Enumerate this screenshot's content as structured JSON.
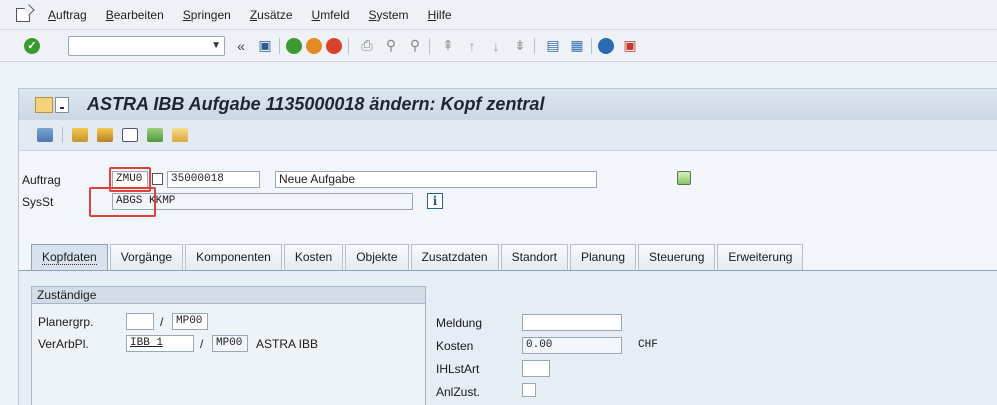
{
  "menu": {
    "items": [
      "Auftrag",
      "Bearbeiten",
      "Springen",
      "Zusätze",
      "Umfeld",
      "System",
      "Hilfe"
    ]
  },
  "toolbar": {
    "back_glyph": "«"
  },
  "title": {
    "text": "ASTRA IBB Aufgabe 1135000018 ändern: Kopf zentral"
  },
  "header": {
    "auftrag_label": "Auftrag",
    "auftrag_type": "ZMU0",
    "auftrag_number": "35000018",
    "auftrag_desc": "Neue Aufgabe",
    "sysst_label": "SysSt",
    "sysst_value": "ABGS KKMP"
  },
  "tabs": [
    "Kopfdaten",
    "Vorgänge",
    "Komponenten",
    "Kosten",
    "Objekte",
    "Zusatzdaten",
    "Standort",
    "Planung",
    "Steuerung",
    "Erweiterung"
  ],
  "zustaendige": {
    "title": "Zuständige",
    "planergrp_label": "Planergrp.",
    "planergrp_value": "",
    "planergrp_werk": "MP00",
    "verarbpl_label": "VerArbPl.",
    "verarbpl_value": "IBB 1",
    "verarbpl_werk": "MP00",
    "verarbpl_text": "ASTRA IBB",
    "slash": "/"
  },
  "right": {
    "meldung_label": "Meldung",
    "meldung_value": "",
    "kosten_label": "Kosten",
    "kosten_value": "0.00",
    "kosten_currency": "CHF",
    "ihlstart_label": "IHLstArt",
    "ihlstart_value": "",
    "anlzust_label": "AnlZust."
  },
  "colors": {
    "highlight": "#e0413e",
    "title_bg": "#ccd7e3"
  }
}
